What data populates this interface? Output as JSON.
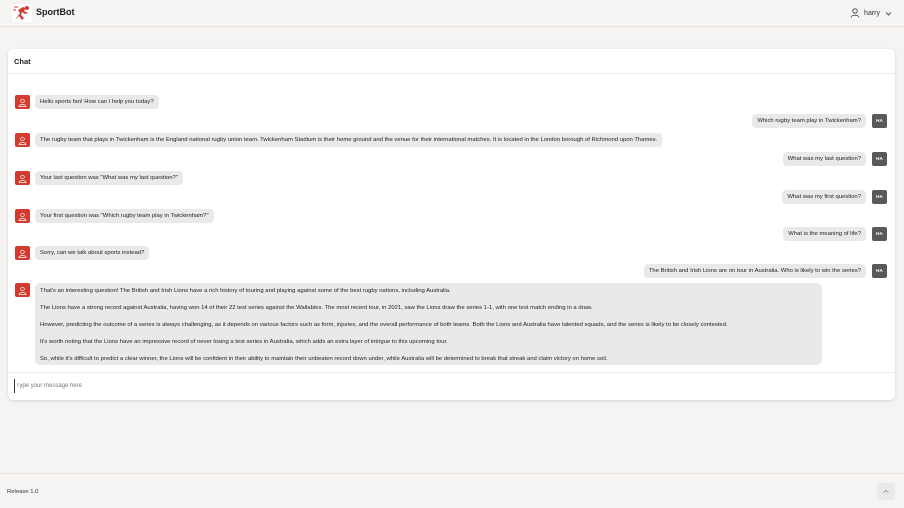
{
  "header": {
    "app_name": "SportBot",
    "username": "harry",
    "logo_icon": "sportbot-logo-icon",
    "user_icon": "user-icon",
    "menu_icon": "chevron-down-icon"
  },
  "chat": {
    "title": "Chat",
    "user_initials": "HA",
    "bot_icon": "bot-icon",
    "messages": [
      {
        "role": "bot",
        "text": "Hello sports fan! How can I help you today?"
      },
      {
        "role": "user",
        "text": "Which rugby team play in Twickenham?"
      },
      {
        "role": "bot",
        "text": "The rugby team that plays in Twickenham is the England national rugby union team. Twickenham Stadium is their home ground and the venue for their international matches. It is located in the London borough of Richmond upon Thames."
      },
      {
        "role": "user",
        "text": "What was my last question?"
      },
      {
        "role": "bot",
        "text": "Your last question was \"What was my last question?\""
      },
      {
        "role": "user",
        "text": "What was my first question?"
      },
      {
        "role": "bot",
        "text": "Your first question was \"Which rugby team play in Twickenham?\""
      },
      {
        "role": "user",
        "text": "What is the meaning of life?"
      },
      {
        "role": "bot",
        "text": "Sorry, can we talk about sports instead?"
      },
      {
        "role": "user",
        "text": "The British and Irish Lions are on tour in Australia. Who is likely to win the series?"
      }
    ],
    "final_reply_paragraphs": [
      "That's an interesting question! The British and Irish Lions have a rich history of touring and playing against some of the best rugby nations, including Australia.",
      "The Lions have a strong record against Australia, having won 14 of their 22 test series against the Wallabies. The most recent tour, in 2021, saw the Lions draw the series 1-1, with one test match ending in a draw.",
      "However, predicting the outcome of a series is always challenging, as it depends on various factors such as form, injuries, and the overall performance of both teams. Both the Lions and Australia have talented squads, and the series is likely to be closely contested.",
      "It's worth noting that the Lions have an impressive record of never losing a test series in Australia, which adds an extra layer of intrigue to this upcoming tour.",
      "So, while it's difficult to predict a clear winner, the Lions will be confident in their ability to maintain their unbeaten record down under, while Australia will be determined to break that streak and claim victory on home soil."
    ],
    "input_placeholder": "Type your message here"
  },
  "footer": {
    "release": "Release 1.0",
    "scroll_top_icon": "chevron-up-icon"
  },
  "colors": {
    "brand": "#d23b2e",
    "user_avatar": "#595959",
    "bubble": "#ebe9e7",
    "background": "#f6f4f2"
  }
}
